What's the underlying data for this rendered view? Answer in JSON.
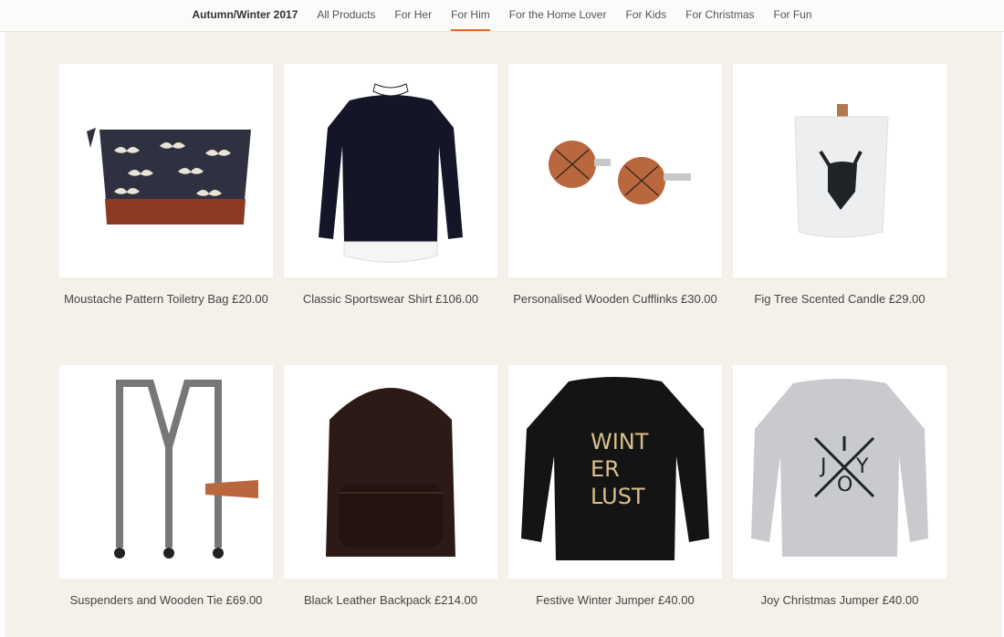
{
  "nav": {
    "tabs": [
      {
        "label": "Autumn/Winter 2017"
      },
      {
        "label": "All Products"
      },
      {
        "label": "For Her"
      },
      {
        "label": "For Him"
      },
      {
        "label": "For the Home Lover"
      },
      {
        "label": "For Kids"
      },
      {
        "label": "For Christmas"
      },
      {
        "label": "For Fun"
      }
    ],
    "active_tab": "For Him"
  },
  "colors": {
    "accent": "#e8642c",
    "background": "#f4f1ea"
  },
  "products": [
    {
      "caption": "Moustache Pattern Toiletry Bag £20.00",
      "image": "toiletry-bag-image"
    },
    {
      "caption": "Classic Sportswear Shirt £106.00",
      "image": "shirt-image"
    },
    {
      "caption": "Personalised Wooden Cufflinks £30.00",
      "image": "cufflinks-image"
    },
    {
      "caption": "Fig Tree Scented Candle £29.00",
      "image": "candle-image"
    },
    {
      "caption": "Suspenders and Wooden Tie £69.00",
      "image": "suspenders-image"
    },
    {
      "caption": "Black Leather Backpack £214.00",
      "image": "backpack-image"
    },
    {
      "caption": "Festive Winter Jumper £40.00",
      "image": "winter-jumper-image",
      "print_lines": [
        "WINT",
        "ER",
        "LUST"
      ]
    },
    {
      "caption": "Joy Christmas Jumper £40.00",
      "image": "joy-jumper-image",
      "print_letters": [
        "J",
        "Y",
        "O"
      ]
    }
  ]
}
